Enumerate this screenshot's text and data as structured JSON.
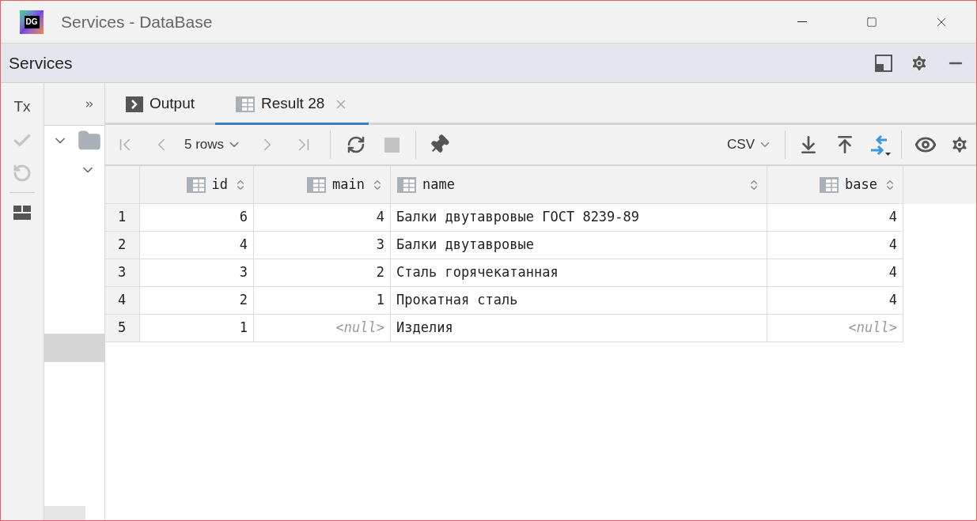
{
  "window": {
    "title": "Services - DataBase",
    "logo": "DG"
  },
  "panel": {
    "title": "Services"
  },
  "side_tools": [
    {
      "kind": "text",
      "label": "Tx",
      "disabled": false
    },
    {
      "kind": "check",
      "disabled": true
    },
    {
      "kind": "undo",
      "disabled": true
    },
    {
      "kind": "layout",
      "disabled": false
    }
  ],
  "tree": {
    "items": [
      {
        "kind": "folder",
        "expanded": true
      },
      {
        "kind": "node",
        "expanded": true
      }
    ]
  },
  "tabs": [
    {
      "kind": "console",
      "label": "Output",
      "selected": false,
      "closable": false
    },
    {
      "kind": "table",
      "label": "Result 28",
      "selected": true,
      "closable": true
    }
  ],
  "toolbar": {
    "rows_label": "5 rows",
    "format": "CSV"
  },
  "table": {
    "columns": [
      {
        "name": "id",
        "kind": "number"
      },
      {
        "name": "main",
        "kind": "number"
      },
      {
        "name": "name",
        "kind": "text"
      },
      {
        "name": "base",
        "kind": "number"
      }
    ],
    "rows": [
      {
        "number": "1",
        "cells": [
          {
            "value": "6",
            "is_null": false
          },
          {
            "value": "4",
            "is_null": false
          },
          {
            "value": "Балки двутавровые ГОСТ 8239-89",
            "is_null": false
          },
          {
            "value": "4",
            "is_null": false
          }
        ]
      },
      {
        "number": "2",
        "cells": [
          {
            "value": "4",
            "is_null": false
          },
          {
            "value": "3",
            "is_null": false
          },
          {
            "value": "Балки двутавровые",
            "is_null": false
          },
          {
            "value": "4",
            "is_null": false
          }
        ]
      },
      {
        "number": "3",
        "cells": [
          {
            "value": "3",
            "is_null": false
          },
          {
            "value": "2",
            "is_null": false
          },
          {
            "value": "Сталь горячекатанная",
            "is_null": false
          },
          {
            "value": "4",
            "is_null": false
          }
        ]
      },
      {
        "number": "4",
        "cells": [
          {
            "value": "2",
            "is_null": false
          },
          {
            "value": "1",
            "is_null": false
          },
          {
            "value": "Прокатная сталь",
            "is_null": false
          },
          {
            "value": "4",
            "is_null": false
          }
        ]
      },
      {
        "number": "5",
        "cells": [
          {
            "value": "1",
            "is_null": false
          },
          {
            "value": "<null>",
            "is_null": true
          },
          {
            "value": "Изделия",
            "is_null": false
          },
          {
            "value": "<null>",
            "is_null": true
          }
        ]
      }
    ]
  }
}
